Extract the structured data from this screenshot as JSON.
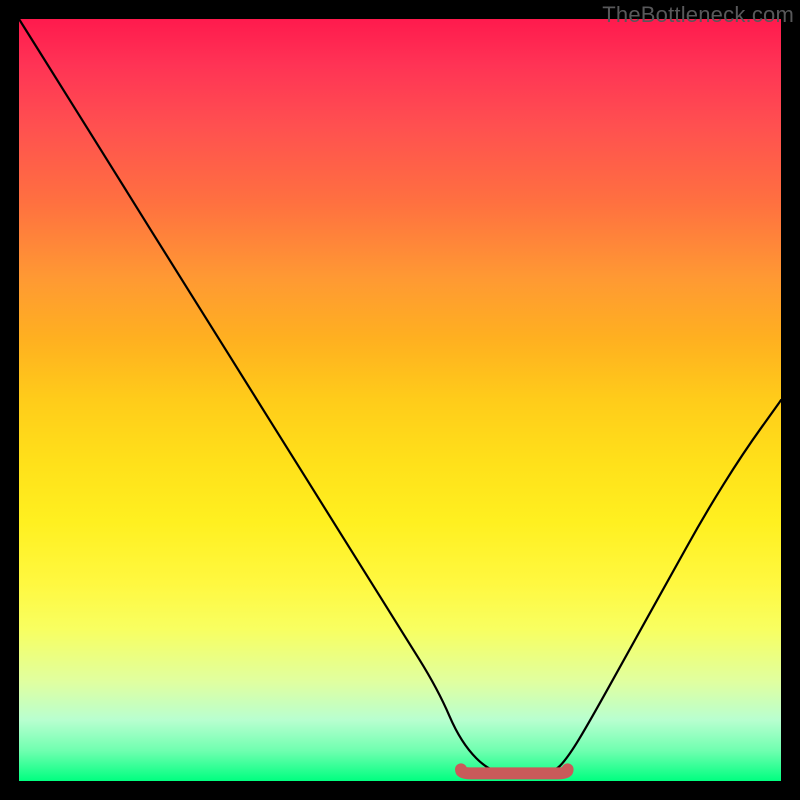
{
  "watermark": "TheBottleneck.com",
  "chart_data": {
    "type": "line",
    "title": "",
    "xlabel": "",
    "ylabel": "",
    "xlim": [
      0,
      100
    ],
    "ylim": [
      0,
      100
    ],
    "grid": false,
    "legend": false,
    "background_gradient_meaning": "green (low/good) at bottom to red (high/bad) at top",
    "series": [
      {
        "name": "bottleneck-curve",
        "color": "#000000",
        "x": [
          0,
          5,
          10,
          15,
          20,
          25,
          30,
          35,
          40,
          45,
          50,
          55,
          58,
          62,
          66,
          70,
          72,
          75,
          80,
          85,
          90,
          95,
          100
        ],
        "y": [
          100,
          92,
          84,
          76,
          68,
          60,
          52,
          44,
          36,
          28,
          20,
          12,
          5,
          1,
          1,
          1,
          3,
          8,
          17,
          26,
          35,
          43,
          50
        ]
      },
      {
        "name": "optimal-range-marker",
        "color": "#c95a5a",
        "style": "thick-flat-segment",
        "x": [
          58,
          72
        ],
        "y": [
          1,
          1
        ]
      }
    ],
    "note": "Axis values are normalized 0–100 estimates; no tick labels are visible in the source image."
  }
}
